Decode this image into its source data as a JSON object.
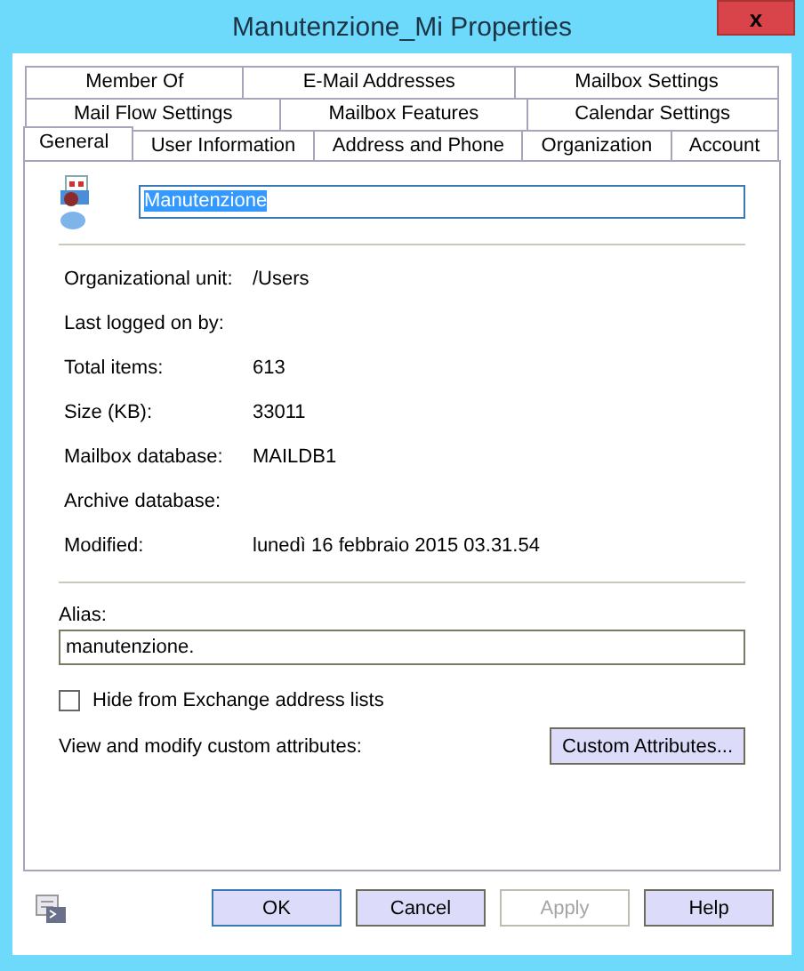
{
  "window": {
    "title": "Manutenzione_Mi Properties",
    "close": "x"
  },
  "tab_rows": [
    [
      {
        "label": "Member Of",
        "selected": false
      },
      {
        "label": "E-Mail Addresses",
        "selected": false
      },
      {
        "label": "Mailbox Settings",
        "selected": false
      }
    ],
    [
      {
        "label": "Mail Flow Settings",
        "selected": false
      },
      {
        "label": "Mailbox Features",
        "selected": false
      },
      {
        "label": "Calendar Settings",
        "selected": false
      }
    ],
    [
      {
        "label": "General",
        "selected": true
      },
      {
        "label": "User Information",
        "selected": false
      },
      {
        "label": "Address and Phone",
        "selected": false
      },
      {
        "label": "Organization",
        "selected": false
      },
      {
        "label": "Account",
        "selected": false
      }
    ]
  ],
  "name_field": {
    "value": "Manutenzione",
    "selected_text": true
  },
  "properties": [
    {
      "label": "Organizational unit:",
      "value": "/Users"
    },
    {
      "label": "Last logged on by:"
    },
    {
      "label": "Total items:",
      "value": "613"
    },
    {
      "label": "Size (KB):",
      "value": "33011"
    },
    {
      "label": "Mailbox database:",
      "value": "MAILDB1"
    },
    {
      "label": "Archive database:"
    },
    {
      "label": "Modified:",
      "value": "lunedì 16 febbraio 2015 03.31.54"
    }
  ],
  "alias": {
    "label": "Alias:",
    "value": "manutenzione."
  },
  "hide_checkbox": {
    "label": "Hide from Exchange address lists",
    "checked": false
  },
  "custom_attributes": {
    "label": "View and modify custom attributes:",
    "button": "Custom Attributes..."
  },
  "buttons": [
    {
      "label": "OK",
      "default": true,
      "disabled": false
    },
    {
      "label": "Cancel",
      "default": false,
      "disabled": false
    },
    {
      "label": "Apply",
      "default": false,
      "disabled": true
    },
    {
      "label": "Help",
      "default": false,
      "disabled": false
    }
  ]
}
